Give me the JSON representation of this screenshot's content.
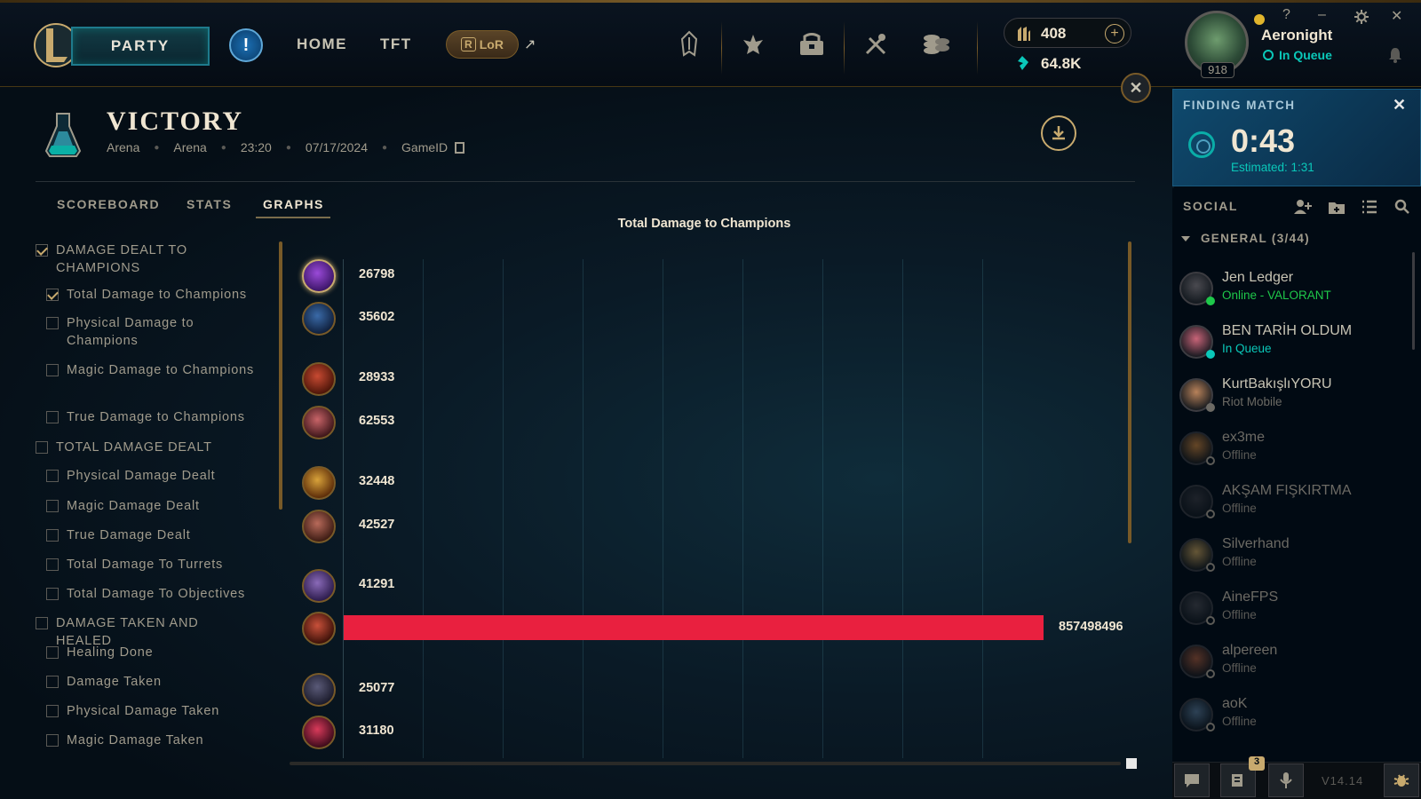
{
  "topbar": {
    "party_label": "PARTY",
    "alert_label": "!",
    "nav": {
      "home": "HOME",
      "tft": "TFT",
      "lor": "LoR"
    },
    "currency": {
      "rp": "408",
      "be": "64.8K"
    },
    "user": {
      "name": "Aeronight",
      "status": "In Queue",
      "level": "918"
    },
    "window_controls": {
      "help": "?",
      "minimize": "–",
      "close": "✕"
    }
  },
  "match": {
    "result": "VICTORY",
    "mode": "Arena",
    "map": "Arena",
    "duration": "23:20",
    "date": "07/17/2024",
    "game_id_label": "GameID"
  },
  "tabs": [
    "SCOREBOARD",
    "STATS",
    "GRAPHS"
  ],
  "active_tab": "GRAPHS",
  "filters": [
    {
      "label": "DAMAGE DEALT TO CHAMPIONS",
      "checked": true,
      "group": true
    },
    {
      "label": "Total Damage to Champions",
      "checked": true,
      "group": false
    },
    {
      "label": "Physical Damage to Champions",
      "checked": false,
      "group": false
    },
    {
      "label": "Magic Damage to Champions",
      "checked": false,
      "group": false
    },
    {
      "label": "True Damage to Champions",
      "checked": false,
      "group": false
    },
    {
      "label": "TOTAL DAMAGE DEALT",
      "checked": false,
      "group": true
    },
    {
      "label": "Physical Damage Dealt",
      "checked": false,
      "group": false
    },
    {
      "label": "Magic Damage Dealt",
      "checked": false,
      "group": false
    },
    {
      "label": "True Damage Dealt",
      "checked": false,
      "group": false
    },
    {
      "label": "Total Damage To Turrets",
      "checked": false,
      "group": false
    },
    {
      "label": "Total Damage To Objectives",
      "checked": false,
      "group": false
    },
    {
      "label": "DAMAGE TAKEN AND HEALED",
      "checked": false,
      "group": true
    },
    {
      "label": "Healing Done",
      "checked": false,
      "group": false
    },
    {
      "label": "Damage Taken",
      "checked": false,
      "group": false
    },
    {
      "label": "Physical Damage Taken",
      "checked": false,
      "group": false
    },
    {
      "label": "Magic Damage Taken",
      "checked": false,
      "group": false
    }
  ],
  "chart_data": {
    "type": "bar",
    "title": "Total Damage to Champions",
    "orientation": "horizontal",
    "values": [
      26798,
      35602,
      28933,
      62553,
      32448,
      42527,
      41291,
      857498496,
      25077,
      31180
    ],
    "labels": [
      "26798",
      "35602",
      "28933",
      "62553",
      "32448",
      "42527",
      "41291",
      "857498496",
      "25077",
      "31180"
    ],
    "highlight_index": 7,
    "highlight_color": "#e9203f"
  },
  "finding_match": {
    "label": "FINDING MATCH",
    "time": "0:43",
    "estimated": "Estimated: 1:31"
  },
  "social": {
    "label": "SOCIAL",
    "group": "GENERAL (3/44)",
    "friends": [
      {
        "name": "Jen Ledger",
        "status": "Online - VALORANT",
        "state": "online",
        "status_color": "#1ec84a"
      },
      {
        "name": "BEN TARİH OLDUM",
        "status": "In Queue",
        "state": "online",
        "status_color": "#0ac8b9"
      },
      {
        "name": "KurtBakışlıYORU",
        "status": "Riot Mobile",
        "state": "online",
        "status_color": "#6c6a64"
      },
      {
        "name": "ex3me",
        "status": "Offline",
        "state": "offline",
        "status_color": "#5b5a56"
      },
      {
        "name": "AKŞAM FIŞKIRTMA",
        "status": "Offline",
        "state": "offline",
        "status_color": "#5b5a56"
      },
      {
        "name": "Silverhand",
        "status": "Offline",
        "state": "offline",
        "status_color": "#5b5a56"
      },
      {
        "name": "AineFPS",
        "status": "Offline",
        "state": "offline",
        "status_color": "#5b5a56"
      },
      {
        "name": "alpereen",
        "status": "Offline",
        "state": "offline",
        "status_color": "#5b5a56"
      },
      {
        "name": "aoK",
        "status": "Offline",
        "state": "offline",
        "status_color": "#5b5a56"
      }
    ]
  },
  "bottom": {
    "badge_count": "3",
    "version": "V14.14"
  },
  "colors": {
    "gold": "#c8aa6e",
    "teal": "#0ac8b9",
    "bar_red": "#e9203f"
  }
}
